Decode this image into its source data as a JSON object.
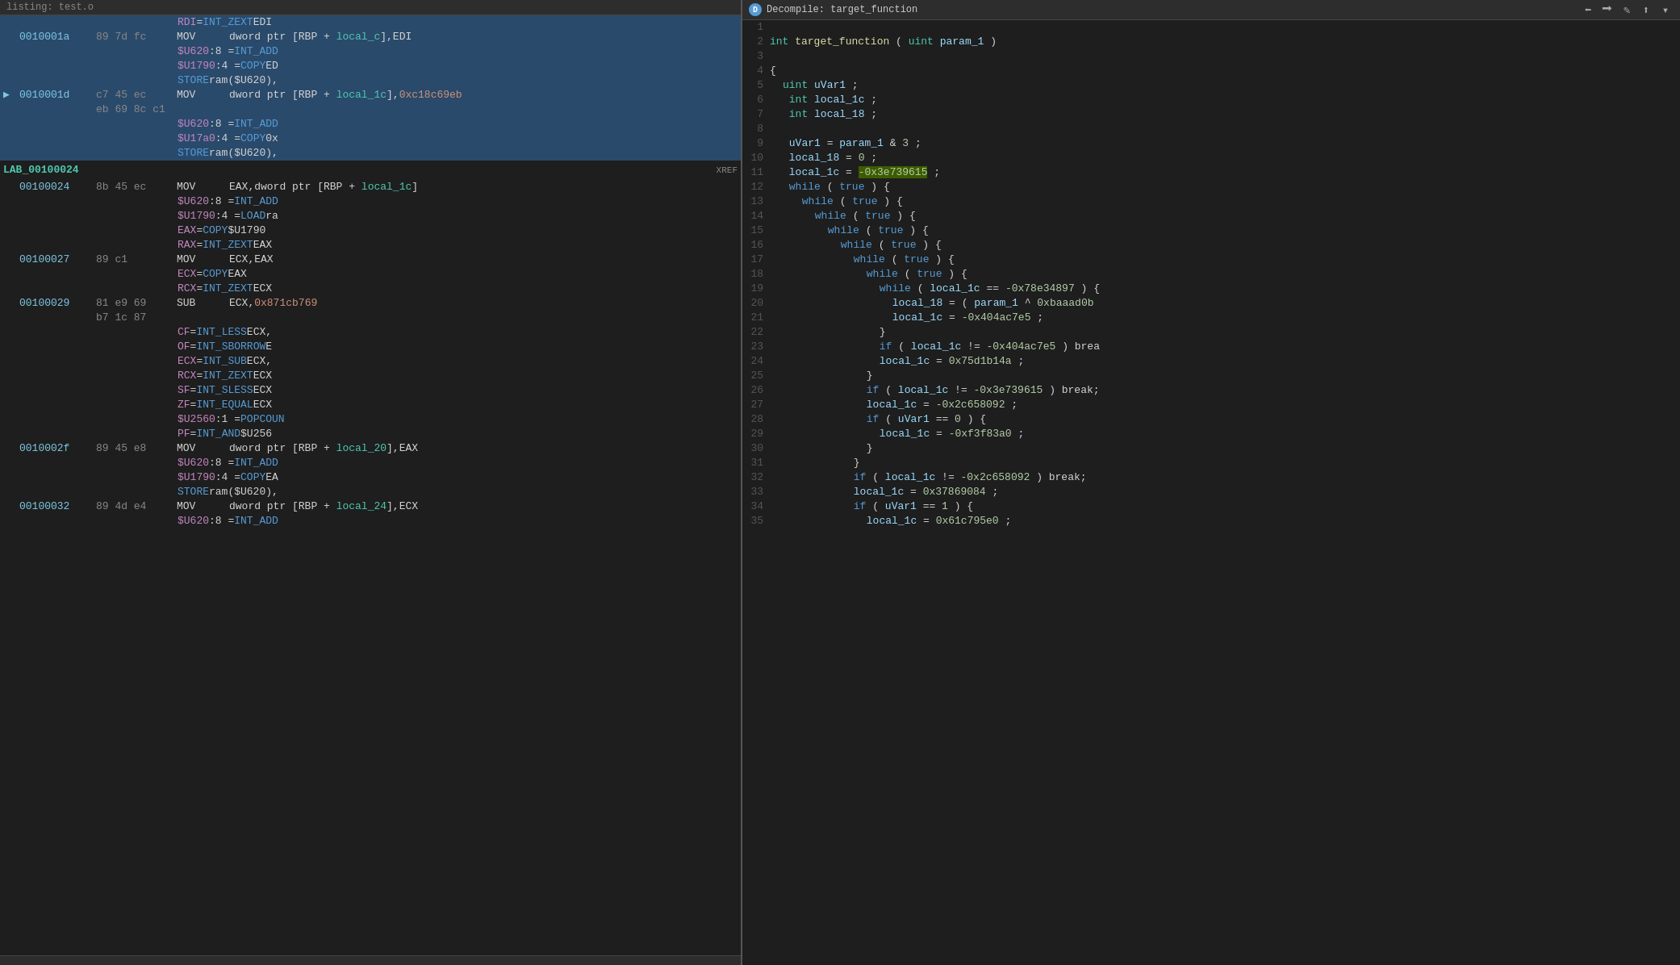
{
  "window": {
    "title": "listing: test.o",
    "decompile_title": "Decompile: target_function"
  },
  "toolbar": {
    "icons": [
      "⊞",
      "⊟",
      "⇒",
      "⇐",
      "📷",
      "≡",
      "▾",
      "✕"
    ]
  },
  "listing": {
    "lines": [
      {
        "type": "pcode",
        "highlighted": true,
        "content": "RDI = INT_ZEXT EDI"
      },
      {
        "type": "asm",
        "highlighted": true,
        "addr": "0010001a",
        "bytes": "89 7d fc",
        "mnemonic": "MOV",
        "operands": [
          {
            "text": "dword ptr [RBP + ",
            "color": "white"
          },
          {
            "text": "local_c",
            "color": "local"
          },
          {
            "text": "],EDI",
            "color": "white"
          }
        ]
      },
      {
        "type": "pcode",
        "highlighted": true,
        "content": "$U620:8 = INT_ADD"
      },
      {
        "type": "pcode",
        "highlighted": true,
        "content": "$U1790:4 = COPY ED"
      },
      {
        "type": "pcode",
        "highlighted": true,
        "content": "STORE ram($U620),"
      },
      {
        "type": "asm",
        "highlighted": true,
        "addr": "0010001d",
        "bytes": "c7 45 ec",
        "mnemonic": "MOV",
        "operands": [
          {
            "text": "dword ptr [RBP + ",
            "color": "white"
          },
          {
            "text": "local_1c",
            "color": "local"
          },
          {
            "text": "],0xc18c69eb",
            "color": "orange"
          }
        ]
      },
      {
        "type": "asm",
        "highlighted": true,
        "addr": "",
        "bytes": "eb 69 8c c1",
        "mnemonic": "",
        "operands": []
      },
      {
        "type": "pcode",
        "highlighted": true,
        "content": "$U620:8 = INT_ADD"
      },
      {
        "type": "pcode",
        "highlighted": true,
        "content": "$U17a0:4 = COPY 0x"
      },
      {
        "type": "pcode",
        "highlighted": true,
        "content": "STORE ram($U620),"
      },
      {
        "type": "label",
        "label": "LAB_00100024",
        "xref": "XREF"
      },
      {
        "type": "asm",
        "highlighted": false,
        "addr": "00100024",
        "bytes": "8b 45 ec",
        "mnemonic": "MOV",
        "operands": [
          {
            "text": "EAX,dword ptr [RBP + ",
            "color": "white"
          },
          {
            "text": "local_1c",
            "color": "local"
          },
          {
            "text": "]",
            "color": "white"
          }
        ]
      },
      {
        "type": "pcode",
        "highlighted": false,
        "content": "$U620:8 = INT_ADD"
      },
      {
        "type": "pcode",
        "highlighted": false,
        "content": "$U1790:4 = LOAD ra"
      },
      {
        "type": "pcode",
        "highlighted": false,
        "content": "EAX = COPY $U1790"
      },
      {
        "type": "pcode",
        "highlighted": false,
        "content": "RAX = INT_ZEXT EAX"
      },
      {
        "type": "asm",
        "highlighted": false,
        "addr": "00100027",
        "bytes": "89 c1",
        "mnemonic": "MOV",
        "operands": [
          {
            "text": "ECX,EAX",
            "color": "white"
          }
        ]
      },
      {
        "type": "pcode",
        "highlighted": false,
        "content": "ECX = COPY EAX"
      },
      {
        "type": "pcode",
        "highlighted": false,
        "content": "RCX = INT_ZEXT ECX"
      },
      {
        "type": "asm",
        "highlighted": false,
        "addr": "00100029",
        "bytes": "81 e9 69",
        "mnemonic": "SUB",
        "operands": [
          {
            "text": "ECX,",
            "color": "white"
          },
          {
            "text": "0x871cb769",
            "color": "orange"
          }
        ]
      },
      {
        "type": "asm",
        "highlighted": false,
        "addr": "",
        "bytes": "b7 1c 87",
        "mnemonic": "",
        "operands": []
      },
      {
        "type": "pcode",
        "highlighted": false,
        "content": "CF = INT_LESS ECX,"
      },
      {
        "type": "pcode",
        "highlighted": false,
        "content": "OF = INT_SBORROW E"
      },
      {
        "type": "pcode",
        "highlighted": false,
        "content": "ECX = INT_SUB ECX,"
      },
      {
        "type": "pcode",
        "highlighted": false,
        "content": "RCX = INT_ZEXT ECX"
      },
      {
        "type": "pcode",
        "highlighted": false,
        "content": "SF = INT_SLESS ECX"
      },
      {
        "type": "pcode",
        "highlighted": false,
        "content": "ZF = INT_EQUAL ECX"
      },
      {
        "type": "pcode",
        "highlighted": false,
        "content": "$U2560:1 = POPCOUN"
      },
      {
        "type": "pcode",
        "highlighted": false,
        "content": "PF = INT_AND $U256"
      },
      {
        "type": "asm",
        "highlighted": false,
        "addr": "0010002f",
        "bytes": "89 45 e8",
        "mnemonic": "MOV",
        "operands": [
          {
            "text": "dword ptr [RBP + ",
            "color": "white"
          },
          {
            "text": "local_20",
            "color": "local"
          },
          {
            "text": "],EAX",
            "color": "white"
          }
        ]
      },
      {
        "type": "pcode",
        "highlighted": false,
        "content": "$U620:8 = INT_ADD"
      },
      {
        "type": "pcode",
        "highlighted": false,
        "content": "$U1790:4 = COPY EA"
      },
      {
        "type": "pcode",
        "highlighted": false,
        "content": "STORE ram($U620),"
      },
      {
        "type": "asm",
        "highlighted": false,
        "addr": "00100032",
        "bytes": "89 4d e4",
        "mnemonic": "MOV",
        "operands": [
          {
            "text": "dword ptr [RBP + ",
            "color": "white"
          },
          {
            "text": "local_24",
            "color": "local"
          },
          {
            "text": "],ECX",
            "color": "white"
          }
        ]
      },
      {
        "type": "pcode",
        "highlighted": false,
        "content": "$U620:8 = INT_ADD"
      }
    ]
  },
  "decompiler": {
    "title": "Decompile: target_function",
    "lines": [
      {
        "num": 1,
        "content": ""
      },
      {
        "num": 2,
        "content": "int target_function(uint param_1)"
      },
      {
        "num": 3,
        "content": ""
      },
      {
        "num": 4,
        "content": "{"
      },
      {
        "num": 5,
        "content": "  uint uVar1;"
      },
      {
        "num": 6,
        "content": "  int local_1c;"
      },
      {
        "num": 7,
        "content": "  int local_18;"
      },
      {
        "num": 8,
        "content": ""
      },
      {
        "num": 9,
        "content": "  uVar1 = param_1 & 3;"
      },
      {
        "num": 10,
        "content": "  local_18 = 0;"
      },
      {
        "num": 11,
        "content": "  local_1c = -0x3e739615;",
        "highlight_val": true
      },
      {
        "num": 12,
        "content": "  while( true ) {"
      },
      {
        "num": 13,
        "content": "    while( true ) {"
      },
      {
        "num": 14,
        "content": "      while( true ) {"
      },
      {
        "num": 15,
        "content": "        while( true ) {"
      },
      {
        "num": 16,
        "content": "          while( true ) {"
      },
      {
        "num": 17,
        "content": "            while( true ) {"
      },
      {
        "num": 18,
        "content": "              while( true ) {"
      },
      {
        "num": 19,
        "content": "                while (local_1c == -0x78e34897) {"
      },
      {
        "num": 20,
        "content": "                  local_18 = (param_1 ^ 0xbaaad0b"
      },
      {
        "num": 21,
        "content": "                  local_1c = -0x404ac7e5;"
      },
      {
        "num": 22,
        "content": "                }"
      },
      {
        "num": 23,
        "content": "                if (local_1c != -0x404ac7e5) brea"
      },
      {
        "num": 24,
        "content": "                local_1c = 0x75d1b14a;"
      },
      {
        "num": 25,
        "content": "              }"
      },
      {
        "num": 26,
        "content": "              if (local_1c != -0x3e739615) break;"
      },
      {
        "num": 27,
        "content": "              local_1c = -0x2c658092;"
      },
      {
        "num": 28,
        "content": "              if (uVar1 == 0) {"
      },
      {
        "num": 29,
        "content": "                local_1c = -0xf3f83a0;"
      },
      {
        "num": 30,
        "content": "              }"
      },
      {
        "num": 31,
        "content": "            }"
      },
      {
        "num": 32,
        "content": "            if (local_1c != -0x2c658092) break;"
      },
      {
        "num": 33,
        "content": "            local_1c = 0x37869084;"
      },
      {
        "num": 34,
        "content": "            if (uVar1 == 1) {"
      },
      {
        "num": 35,
        "content": "              local_1c = 0x61c795e0;"
      }
    ]
  }
}
